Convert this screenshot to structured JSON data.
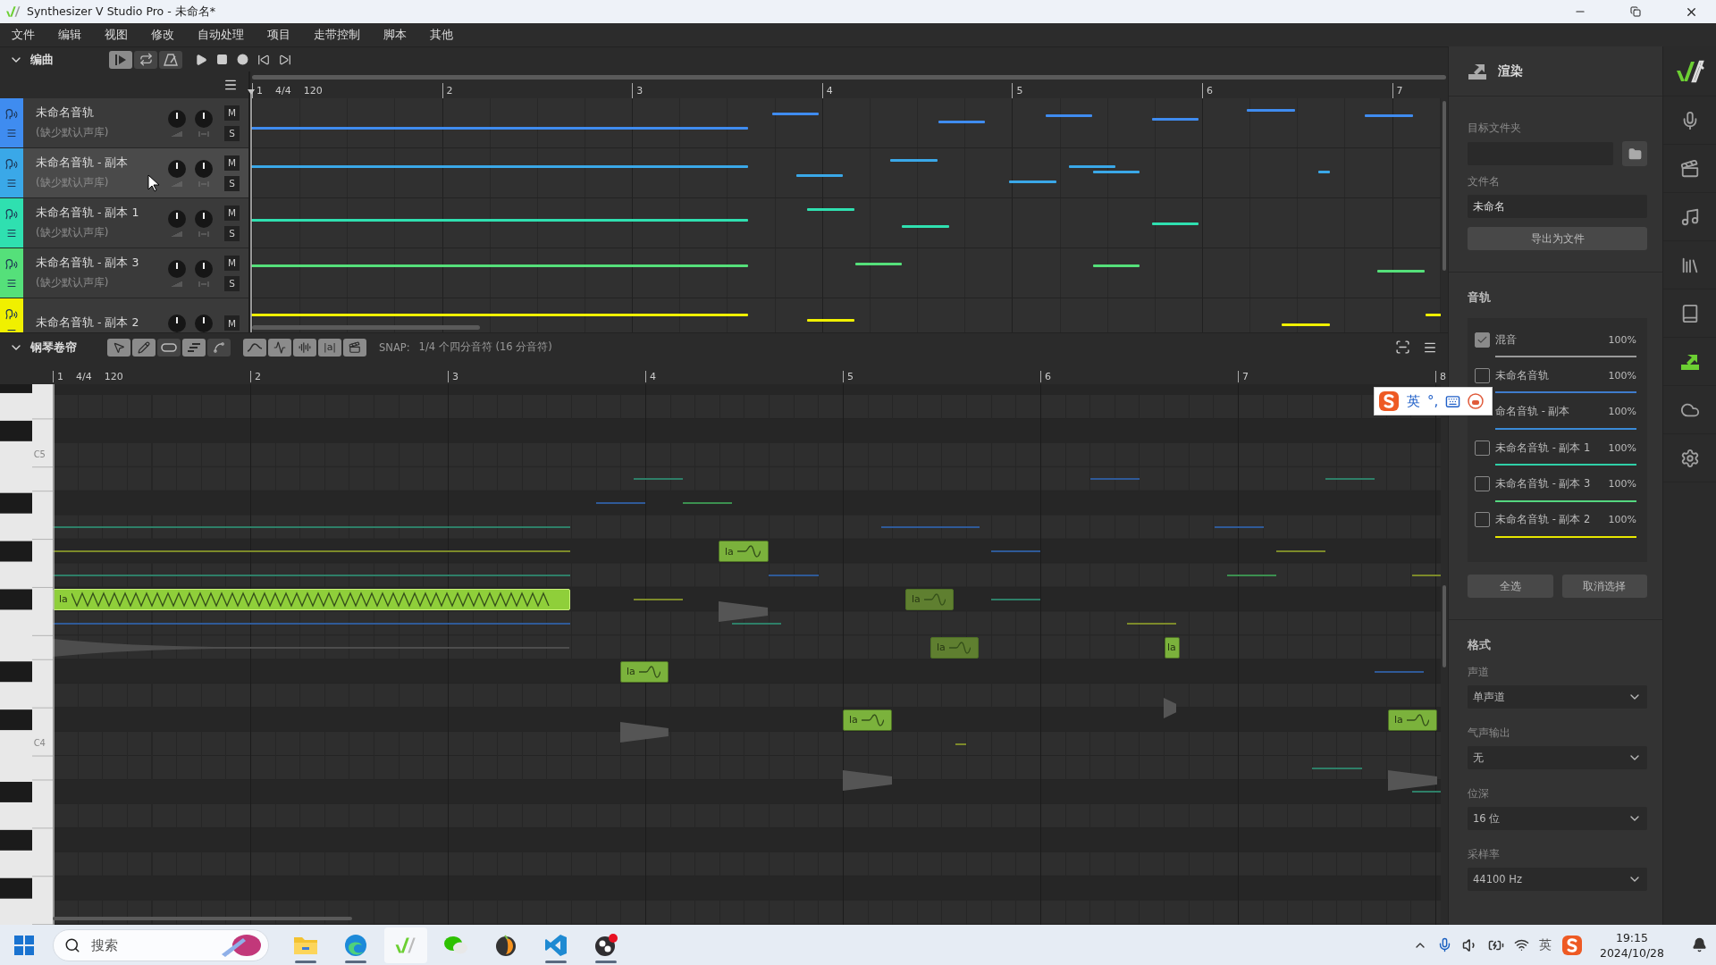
{
  "title_bar": {
    "title": "Synthesizer V Studio Pro - 未命名*"
  },
  "menu": [
    "文件",
    "编辑",
    "视图",
    "修改",
    "自动处理",
    "项目",
    "走带控制",
    "脚本",
    "其他"
  ],
  "arrangement": {
    "title": "编曲",
    "tools": [
      {
        "kind": "pointer",
        "selected": true
      },
      {
        "kind": "loop",
        "selected": false
      },
      {
        "kind": "metronome",
        "selected": false
      }
    ],
    "ruler": {
      "measures": [
        "1",
        "2",
        "3",
        "4",
        "5",
        "6",
        "7"
      ],
      "time_signature": "4/4",
      "tempo": "120"
    },
    "tracks": [
      {
        "name": "未命名音轨",
        "subtitle": "(缺少默认声库)",
        "color": "#3f8cf0",
        "selected": false,
        "mute": "M",
        "solo": "S"
      },
      {
        "name": "未命名音轨 - 副本",
        "subtitle": "(缺少默认声库)",
        "color": "#3aa8e8",
        "selected": true,
        "mute": "M",
        "solo": "S"
      },
      {
        "name": "未命名音轨 - 副本 1",
        "subtitle": "(缺少默认声库)",
        "color": "#2fe0b0",
        "selected": false,
        "mute": "M",
        "solo": "S"
      },
      {
        "name": "未命名音轨 - 副本 3",
        "subtitle": "(缺少默认声库)",
        "color": "#55e07a",
        "selected": false,
        "mute": "M",
        "solo": "S"
      },
      {
        "name": "未命名音轨 - 副本 2",
        "color": "#f0f000",
        "selected": false,
        "mute": "M"
      }
    ]
  },
  "piano_roll": {
    "title": "钢琴卷帘",
    "tools": [
      {
        "kind": "select",
        "selected": true
      },
      {
        "kind": "pen",
        "selected": true
      },
      {
        "kind": "capsule",
        "selected": false
      },
      {
        "kind": "notes",
        "selected": true
      },
      {
        "kind": "curve",
        "selected": false
      }
    ],
    "views": [
      {
        "kind": "pitch",
        "selected": true
      },
      {
        "kind": "vibrato",
        "selected": true
      },
      {
        "kind": "waveform",
        "selected": true
      },
      {
        "kind": "phoneme",
        "label": "|a|",
        "selected": true
      },
      {
        "kind": "video",
        "selected": true
      }
    ],
    "snap_label": "SNAP:",
    "snap_value": "1/4 个四分音符 (16 分音符)",
    "ruler": {
      "measures": [
        "1",
        "2",
        "3",
        "4",
        "5",
        "6",
        "7",
        "8"
      ],
      "time_signature": "4/4",
      "tempo": "120"
    },
    "key_labels": [
      "C5",
      "C4"
    ],
    "notes": [
      {
        "lyric": "la",
        "selected": true,
        "dimmed": false
      },
      {
        "lyric": "la",
        "selected": false,
        "dimmed": false
      },
      {
        "lyric": "la",
        "selected": false,
        "dimmed": false
      },
      {
        "lyric": "la",
        "selected": false,
        "dimmed": false
      },
      {
        "lyric": "la",
        "selected": false,
        "dimmed": true
      },
      {
        "lyric": "la",
        "selected": false,
        "dimmed": true
      },
      {
        "lyric": "la",
        "selected": false,
        "dimmed": false
      },
      {
        "lyric": "la",
        "selected": false,
        "dimmed": false
      }
    ]
  },
  "ime_bar": {
    "mode": "英",
    "punctuation": "°,"
  },
  "render_panel": {
    "title": "渲染",
    "folder_label": "目标文件夹",
    "filename_label": "文件名",
    "filename": "未命名",
    "export_button": "导出为文件",
    "tracks_title": "音轨",
    "tracks": [
      {
        "name": "混音",
        "reading": "100%",
        "checked": true,
        "color": "#9a9a9a"
      },
      {
        "name": "未命名音轨",
        "reading": "100%",
        "checked": false,
        "color": "#3f7ccc"
      },
      {
        "name": "命名音轨 - 副本",
        "reading": "100%",
        "color": "#3a8ad8"
      },
      {
        "name": "未命名音轨 - 副本 1",
        "reading": "100%",
        "checked": false,
        "color": "#2fd0a8"
      },
      {
        "name": "未命名音轨 - 副本 3",
        "reading": "100%",
        "checked": false,
        "color": "#55d880"
      },
      {
        "name": "未命名音轨 - 副本 2",
        "reading": "100%",
        "checked": false,
        "color": "#e8e800"
      }
    ],
    "select_all": "全选",
    "deselect": "取消选择",
    "format_title": "格式",
    "settings": [
      {
        "label": "声道",
        "value": "单声道"
      },
      {
        "label": "气声输出",
        "value": "无"
      },
      {
        "label": "位深",
        "value": "16 位"
      },
      {
        "label": "采样率",
        "value": "44100 Hz"
      }
    ]
  },
  "sidebar": {
    "items": [
      {
        "kind": "voice",
        "selected": false
      },
      {
        "kind": "video",
        "selected": false
      },
      {
        "kind": "note",
        "selected": false
      },
      {
        "kind": "library",
        "selected": false
      },
      {
        "kind": "lyrics",
        "selected": false
      },
      {
        "kind": "render",
        "selected": true
      },
      {
        "kind": "cloud",
        "selected": false
      },
      {
        "kind": "settings",
        "selected": false
      }
    ]
  },
  "taskbar": {
    "search_placeholder": "搜索",
    "apps": [
      {
        "kind": "files",
        "running": true,
        "selected": false
      },
      {
        "kind": "browser",
        "running": true,
        "selected": false
      },
      {
        "kind": "synth",
        "running": false,
        "selected": true
      },
      {
        "kind": "chat",
        "running": false,
        "selected": false
      },
      {
        "kind": "daw",
        "running": false,
        "selected": false
      },
      {
        "kind": "editor",
        "running": true,
        "selected": false
      },
      {
        "kind": "recorder",
        "running": true,
        "selected": false
      }
    ],
    "tray_language": "英",
    "time": "19:15",
    "date": "2024/10/28"
  }
}
